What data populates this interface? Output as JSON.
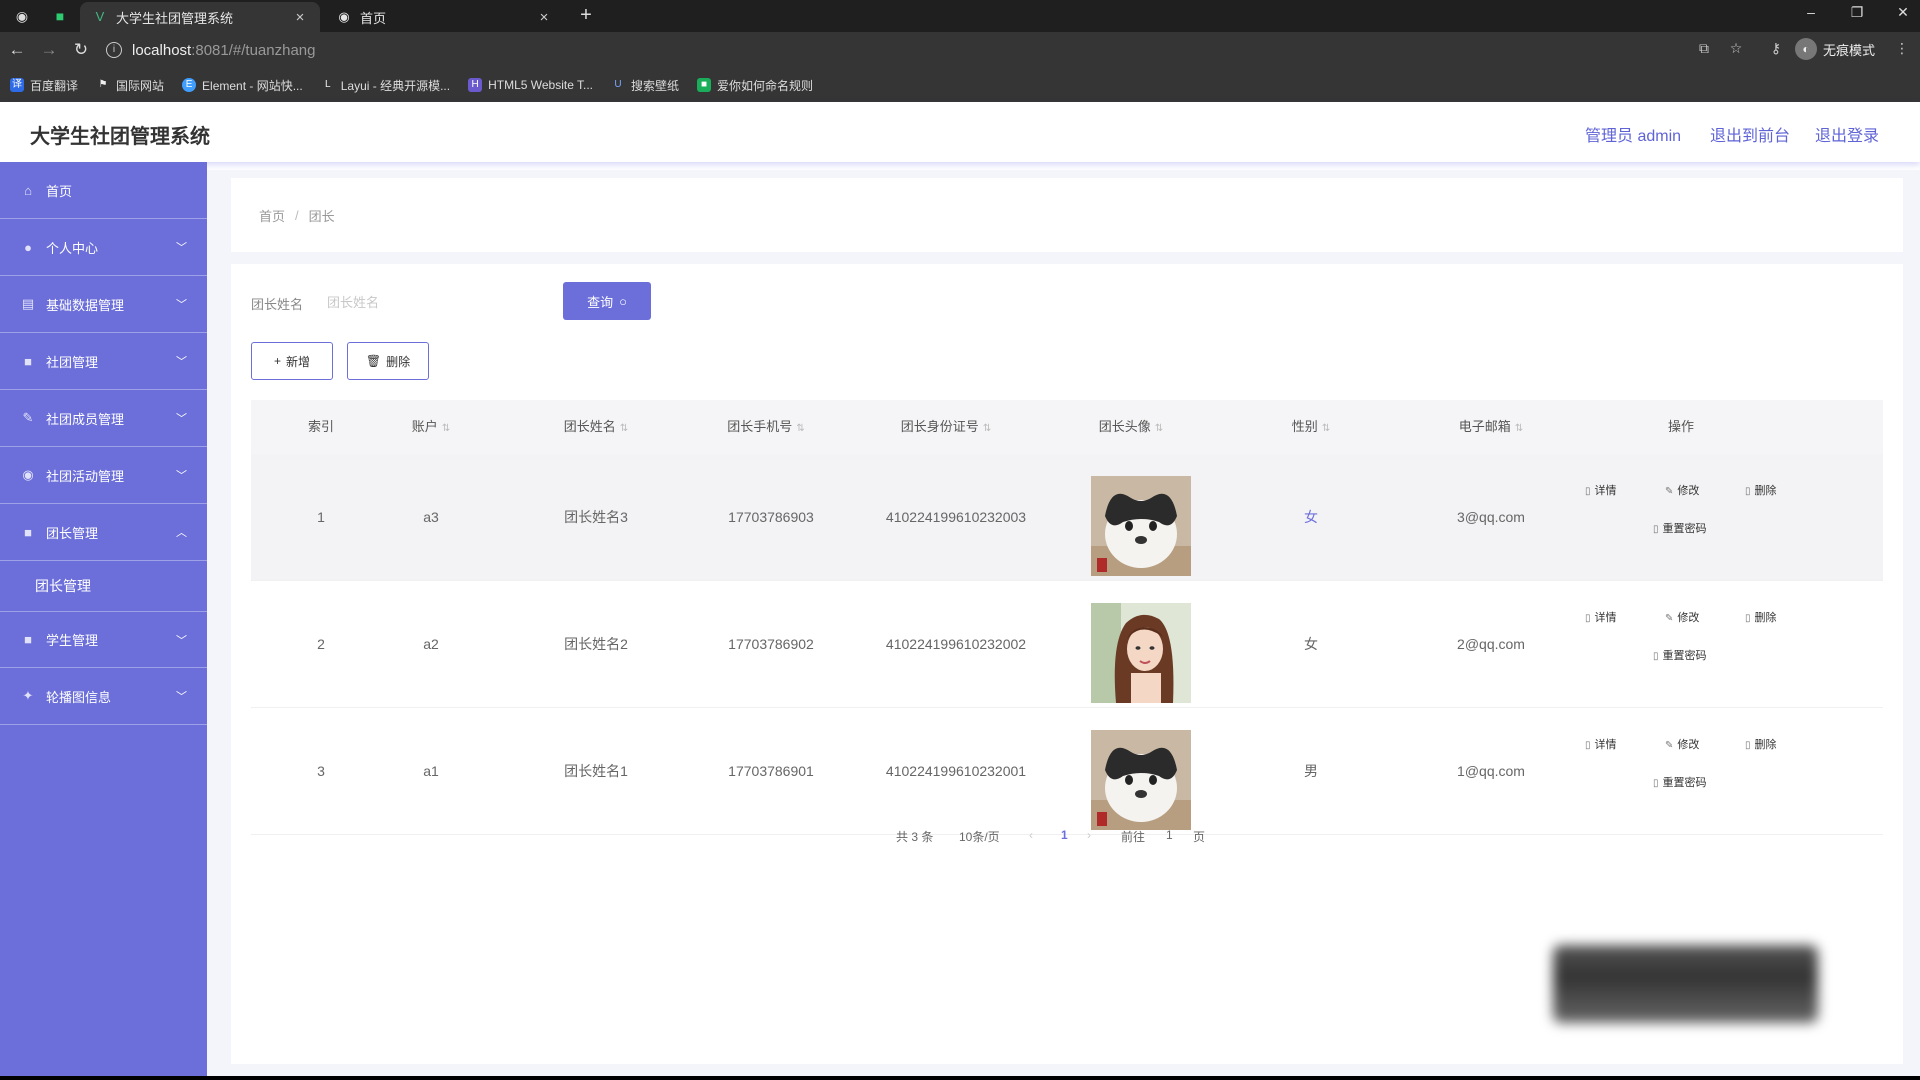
{
  "browser": {
    "tabs": [
      {
        "title": "大学生社团管理系统",
        "active": true
      },
      {
        "title": "首页",
        "active": false
      }
    ],
    "url_host": "localhost",
    "url_rest": ":8081/#/tuanzhang",
    "profile_label": "无痕模式",
    "bookmarks": [
      "百度翻译",
      "国际网站",
      "Element - 网站快...",
      "Layui - 经典开源模...",
      "HTML5 Website T...",
      "搜索壁纸",
      "爱你如何命名规则"
    ]
  },
  "header": {
    "title": "大学生社团管理系统",
    "admin_label": "管理员 admin",
    "back_label": "退出到前台",
    "logout_label": "退出登录"
  },
  "sidebar": {
    "items": [
      {
        "label": "首页",
        "icon": "home-icon",
        "arrow": ""
      },
      {
        "label": "个人中心",
        "icon": "user-icon",
        "arrow": "﹀"
      },
      {
        "label": "基础数据管理",
        "icon": "data-icon",
        "arrow": "﹀"
      },
      {
        "label": "社团管理",
        "icon": "club-icon",
        "arrow": "﹀"
      },
      {
        "label": "社团成员管理",
        "icon": "members-icon",
        "arrow": "﹀"
      },
      {
        "label": "社团活动管理",
        "icon": "activity-icon",
        "arrow": "﹀"
      },
      {
        "label": "团长管理",
        "icon": "leader-icon",
        "arrow": "︿"
      },
      {
        "label": "学生管理",
        "icon": "student-icon",
        "arrow": "﹀"
      },
      {
        "label": "轮播图信息",
        "icon": "carousel-icon",
        "arrow": "﹀"
      }
    ],
    "subitem": "团长管理"
  },
  "breadcrumb": {
    "home": "首页",
    "current": "团长"
  },
  "search": {
    "label": "团长姓名",
    "placeholder": "团长姓名",
    "button": "查询"
  },
  "actions": {
    "add": "新增",
    "delete": "删除"
  },
  "table": {
    "headers": {
      "index": "索引",
      "account": "账户",
      "name": "团长姓名",
      "phone": "团长手机号",
      "idcard": "团长身份证号",
      "avatar": "团长头像",
      "gender": "性别",
      "email": "电子邮箱",
      "ops": "操作"
    },
    "rows": [
      {
        "index": "1",
        "account": "a3",
        "name": "团长姓名3",
        "phone": "17703786903",
        "idcard": "410224199610232003",
        "gender": "女",
        "email": "3@qq.com",
        "avatar": "dog"
      },
      {
        "index": "2",
        "account": "a2",
        "name": "团长姓名2",
        "phone": "17703786902",
        "idcard": "410224199610232002",
        "gender": "女",
        "email": "2@qq.com",
        "avatar": "girl"
      },
      {
        "index": "3",
        "account": "a1",
        "name": "团长姓名1",
        "phone": "17703786901",
        "idcard": "410224199610232001",
        "gender": "男",
        "email": "1@qq.com",
        "avatar": "dog"
      }
    ],
    "op_labels": {
      "detail": "详情",
      "edit": "修改",
      "delete": "删除",
      "reset": "重置密码"
    }
  },
  "pager": {
    "total": "共 3 条",
    "page_size": "10条/页",
    "current": "1",
    "goto_label": "前往",
    "goto_value": "1",
    "page_suffix": "页"
  },
  "colors": {
    "accent": "#6c6fda",
    "header_link": "#5f63d6"
  }
}
